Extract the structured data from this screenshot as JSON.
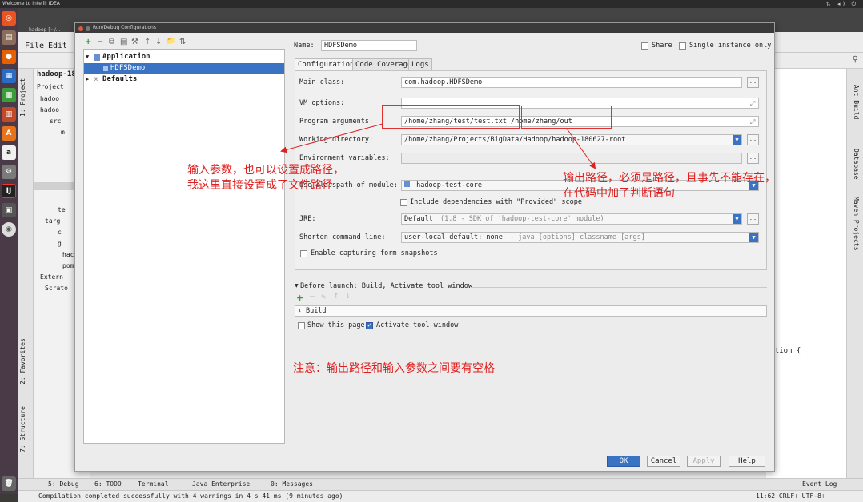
{
  "os": {
    "topbar_title": "Welcome to IntelliJ IDEA",
    "topbar_icons": "⇅ ◂) ⏻"
  },
  "launcher_icons": [
    "ubuntu-icon",
    "files-icon",
    "firefox-icon",
    "writer-icon",
    "calc-icon",
    "impress-icon",
    "software-icon",
    "amazon-icon",
    "settings-icon",
    "terminal-icon",
    "save-icon",
    "disc-icon",
    "trash-icon"
  ],
  "ide": {
    "window_title": "hadoop [~/...",
    "menu": [
      "File",
      "Edit"
    ],
    "project_tree": [
      "hadoop-18",
      "Project",
      "hadoo",
      "hadoo",
      "src",
      "m",
      "te",
      "targ",
      "c",
      "g",
      "hack",
      "pom.",
      "Extern",
      "Scrato"
    ],
    "left_tabs": [
      "1: Project",
      "2: Favorites",
      "7: Structure"
    ],
    "right_tabs": [
      "Ant Build",
      "Database",
      "Maven Projects"
    ],
    "editor_text": "eption {",
    "bottom_tools": [
      "5: Debug",
      "6: TODO",
      "Terminal",
      "Java Enterprise",
      "0: Messages",
      "Event Log"
    ],
    "status_text": "Compilation completed successfully with 4 warnings in 4 s 41 ms (9 minutes ago)",
    "status_right": "11:62  CRLF÷  UTF-8÷"
  },
  "dialog": {
    "title": "Run/Debug Configurations",
    "tree": {
      "application": "Application",
      "config": "HDFSDemo",
      "defaults": "Defaults"
    },
    "name_label": "Name:",
    "name_value": "HDFSDemo",
    "share_label": "Share",
    "single_instance_label": "Single instance only",
    "tabs": [
      "Configuration",
      "Code Coverage",
      "Logs"
    ],
    "main_class_label": "Main class:",
    "main_class_value": "com.hadoop.HDFSDemo",
    "vm_options_label": "VM options:",
    "program_args_label": "Program arguments:",
    "program_args_value": "/home/zhang/test/test.txt /home/zhang/out",
    "working_dir_label": "Working directory:",
    "working_dir_value": "/home/zhang/Projects/BigData/Hadoop/hadoop-180627-root",
    "env_label": "Environment variables:",
    "classpath_label": "Use classpath of module:",
    "classpath_value": "hadoop-test-core",
    "include_deps_label": "Include dependencies with \"Provided\" scope",
    "jre_label": "JRE:",
    "jre_value": "Default",
    "jre_hint": "(1.8 - SDK of 'hadoop-test-core' module)",
    "shorten_label": "Shorten command line:",
    "shorten_value": "user-local default: none",
    "shorten_hint": "- java [options] classname [args]",
    "enable_snapshots_label": "Enable capturing form snapshots",
    "before_launch_label": "Before launch: Build, Activate tool window",
    "before_launch_item": "Build",
    "show_page_label": "Show this page",
    "activate_tool_label": "Activate tool window",
    "ok": "OK",
    "cancel": "Cancel",
    "apply": "Apply",
    "help": "Help",
    "ellipsis": "...",
    "toolbar_glyphs": [
      "+",
      "−",
      "⧉",
      "▤",
      "⚒",
      "↑",
      "↓",
      "📁",
      "⇅"
    ],
    "before_launch_glyphs": [
      "+",
      "−",
      "✎",
      "↑",
      "↓"
    ]
  },
  "annotations": {
    "input_line1": "输入参数，也可以设置成路径，",
    "input_line2": "我这里直接设置成了文件路径",
    "output_line1": "输出路径，必须是路径，且事先不能存在，",
    "output_line2": "在代码中加了判断语句",
    "note": "注意：输出路径和输入参数之间要有空格"
  }
}
